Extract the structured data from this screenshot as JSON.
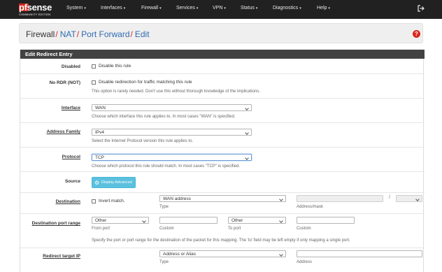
{
  "logo": {
    "brand": "sense",
    "brand_prefix": "pf",
    "subtitle": "COMMUNITY EDITION"
  },
  "nav": {
    "items": [
      "System",
      "Interfaces",
      "Firewall",
      "Services",
      "VPN",
      "Status",
      "Diagnostics",
      "Help"
    ],
    "caret": "▾"
  },
  "breadcrumb": {
    "root": "Firewall",
    "items": [
      "NAT",
      "Port Forward",
      "Edit"
    ]
  },
  "help_icon": "?",
  "panel_title": "Edit Redirect Entry",
  "form": {
    "disabled": {
      "label": "Disabled",
      "checkbox_text": "Disable this rule"
    },
    "no_rdr": {
      "label": "No RDR (NOT)",
      "checkbox_text": "Disable redirection for traffic matching this rule",
      "help": "This option is rarely needed. Don't use this without thorough knowledge of the implications."
    },
    "interface": {
      "label": "Interface",
      "value": "WAN",
      "help": "Choose which interface this rule applies to. In most cases \"WAN\" is specified."
    },
    "address_family": {
      "label": "Address Family",
      "value": "IPv4",
      "help": "Select the Internet Protocol version this rule applies to."
    },
    "protocol": {
      "label": "Protocol",
      "value": "TCP",
      "help": "Choose which protocol this rule should match. In most cases \"TCP\" is specified."
    },
    "source": {
      "label": "Source",
      "button": "Display Advanced"
    },
    "destination": {
      "label": "Destination",
      "invert_text": "Invert match.",
      "type_value": "WAN address",
      "type_caption": "Type",
      "address_caption": "Address/mask",
      "slash": "/"
    },
    "dest_port_range": {
      "label": "Destination port range",
      "from_value": "Other",
      "from_caption": "From port",
      "custom_caption": "Custom",
      "to_value": "Other",
      "to_caption": "To port",
      "custom2_caption": "Custom",
      "help": "Specify the port or port range for the destination of the packet for this mapping. The 'to' field may be left empty if only mapping a single port."
    },
    "redirect_target_ip": {
      "label": "Redirect target IP",
      "type_value": "Address or Alias",
      "type_caption": "Type",
      "address_caption": "Address"
    }
  },
  "colors": {
    "navbar": "#212121",
    "accent_red": "#d9261c",
    "link_blue": "#2f6bb2",
    "panel_head": "#424242",
    "button_info": "#5bc0de"
  }
}
